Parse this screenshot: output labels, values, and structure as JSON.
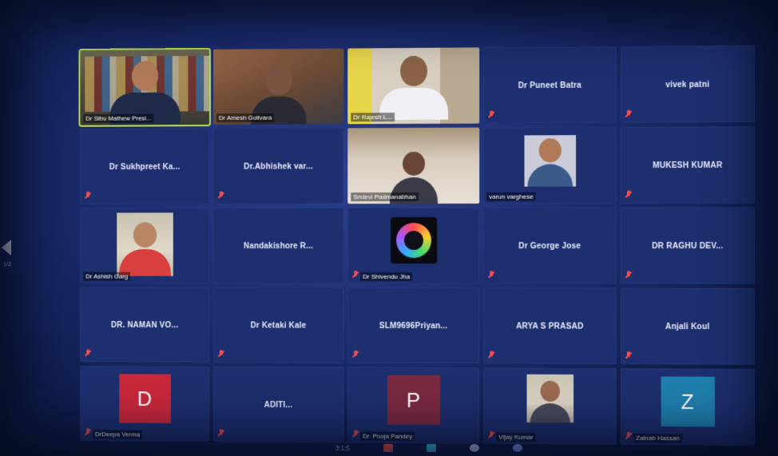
{
  "sidebar": {
    "page_indicator": "1/3"
  },
  "toolbar": {
    "time_text": "3:1:5"
  },
  "participants": [
    {
      "label": "Dr Sibu Mathew Presi...",
      "kind": "video"
    },
    {
      "label": "Dr Amesh Golivara",
      "kind": "video"
    },
    {
      "label": "Dr Rajesh L...",
      "kind": "video"
    },
    {
      "name": "Dr Puneet Batra",
      "kind": "name"
    },
    {
      "name": "vivek patni",
      "kind": "name"
    },
    {
      "name": "Dr Sukhpreet Ka...",
      "kind": "name"
    },
    {
      "name": "Dr.Abhishek var...",
      "kind": "name"
    },
    {
      "label": "Sridevi Padmanabhan",
      "kind": "video"
    },
    {
      "label": "varun varghese",
      "kind": "video"
    },
    {
      "name": "MUKESH KUMAR",
      "kind": "name"
    },
    {
      "label": "Dr Ashish Garg",
      "kind": "video"
    },
    {
      "name": "Nandakishore R...",
      "kind": "name"
    },
    {
      "label": "Dr Shivendu Jha",
      "kind": "logo"
    },
    {
      "name": "Dr George Jose",
      "kind": "name"
    },
    {
      "name": "DR RAGHU DEV...",
      "kind": "name"
    },
    {
      "name": "DR. NAMAN VO...",
      "kind": "name"
    },
    {
      "name": "Dr Ketaki Kale",
      "kind": "name"
    },
    {
      "name": "SLM9696Priyan...",
      "kind": "name"
    },
    {
      "name": "ARYA S PRASAD",
      "kind": "name"
    },
    {
      "name": "Anjali Koul",
      "kind": "name"
    },
    {
      "label": "DrDeepa Verma",
      "kind": "avatar",
      "letter": "D",
      "color": "#c8283a"
    },
    {
      "name": "ADITI...",
      "kind": "name"
    },
    {
      "label": "Dr. Pooja Pandey",
      "kind": "avatar",
      "letter": "P",
      "color": "#7a2a40"
    },
    {
      "label": "Vijay Kumar",
      "kind": "video"
    },
    {
      "label": "Zainab Hassan",
      "kind": "avatar",
      "letter": "Z",
      "color": "#1f7fae"
    }
  ],
  "colors": {
    "background": "#1a2a6a",
    "tile": "#1d2f6e",
    "active_speaker_border": "#b8e04a",
    "muted_icon": "#ff4b4b"
  }
}
